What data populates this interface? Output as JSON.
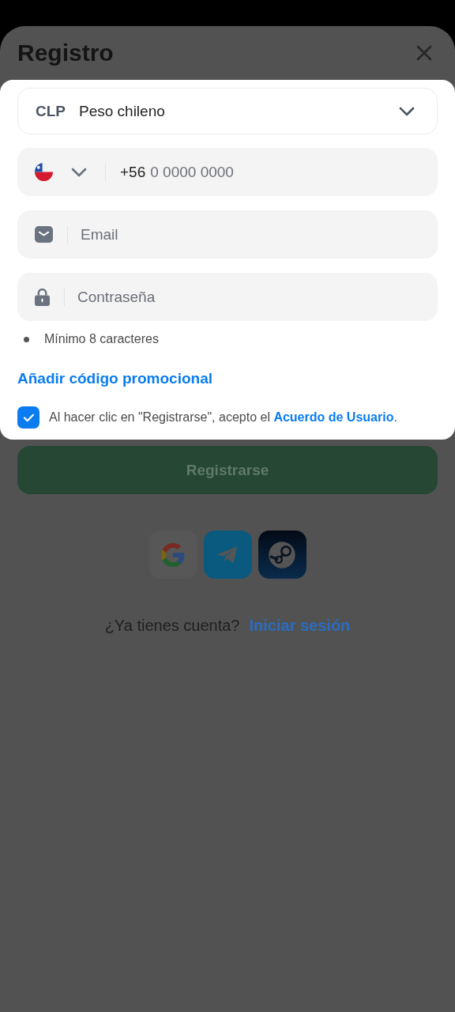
{
  "header": {
    "title": "Registro"
  },
  "currency": {
    "code": "CLP",
    "name": "Peso chileno"
  },
  "phone": {
    "prefix": "+56",
    "placeholder": "0 0000 0000"
  },
  "email": {
    "placeholder": "Email"
  },
  "password": {
    "placeholder": "Contraseña"
  },
  "password_rules": [
    {
      "text": "Mínimo 8 caracteres"
    }
  ],
  "promo_link": "Añadir código promocional",
  "agreement": {
    "checked": true,
    "text": "Al hacer clic en \"Registrarse\", acepto el",
    "link": "Acuerdo de Usuario",
    "end": "."
  },
  "submit": "Registrarse",
  "social": [
    {
      "kind": "google"
    },
    {
      "kind": "telegram"
    },
    {
      "kind": "steam"
    }
  ],
  "login_prompt": {
    "text": "¿Ya tienes cuenta?",
    "link": "Iniciar sesión"
  }
}
